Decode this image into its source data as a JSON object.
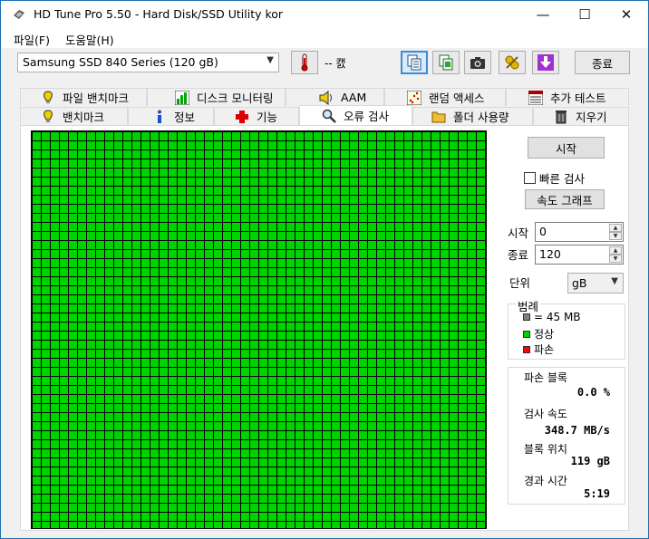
{
  "window": {
    "title": "HD Tune Pro 5.50 - Hard Disk/SSD Utility kor",
    "minimize": "—",
    "maximize": "☐",
    "close": "✕"
  },
  "menu": {
    "file": "파일(F)",
    "help": "도움말(H)"
  },
  "toolbar": {
    "drive": "Samsung SSD 840 Series (120 gB)",
    "temperature": "-- 캜",
    "exit_label": "종료"
  },
  "tabs_row1": [
    {
      "label": "파일 밴치마크",
      "icon": "file-benchmark-icon"
    },
    {
      "label": "디스크 모니터링",
      "icon": "disk-monitor-icon"
    },
    {
      "label": "AAM",
      "icon": "speaker-icon"
    },
    {
      "label": "랜덤 액세스",
      "icon": "random-access-icon"
    },
    {
      "label": "추가 테스트",
      "icon": "extra-tests-icon"
    }
  ],
  "tabs_row2": [
    {
      "label": "밴치마크",
      "icon": "benchmark-icon"
    },
    {
      "label": "정보",
      "icon": "info-icon"
    },
    {
      "label": "기능",
      "icon": "health-icon"
    },
    {
      "label": "오류 검사",
      "icon": "magnifier-icon",
      "selected": true
    },
    {
      "label": "폴더 사용량",
      "icon": "folder-icon"
    },
    {
      "label": "지우기",
      "icon": "trash-icon"
    }
  ],
  "controls": {
    "start_label": "시작",
    "quick_scan_label": "빠른 검사",
    "quick_scan_checked": false,
    "speed_graph_label": "속도 그래프",
    "start_field_label": "시작",
    "start_value": "0",
    "end_field_label": "종료",
    "end_value": "120",
    "unit_label": "단위",
    "unit_value": "gB"
  },
  "legend": {
    "title": "범례",
    "block_size": "= 45 MB",
    "ok": "정상",
    "damaged": "파손",
    "colors": {
      "block": "#808080",
      "ok": "#00d400",
      "damaged": "#ff0000"
    }
  },
  "stats": {
    "damaged_blocks_label": "파손 블록",
    "damaged_blocks_value": "0.0 %",
    "scan_speed_label": "검사 속도",
    "scan_speed_value": "348.7 MB/s",
    "block_position_label": "블록 위치",
    "block_position_value": "119 gB",
    "elapsed_label": "경과 시간",
    "elapsed_value": "5:19"
  },
  "scan_progress": 1.0
}
